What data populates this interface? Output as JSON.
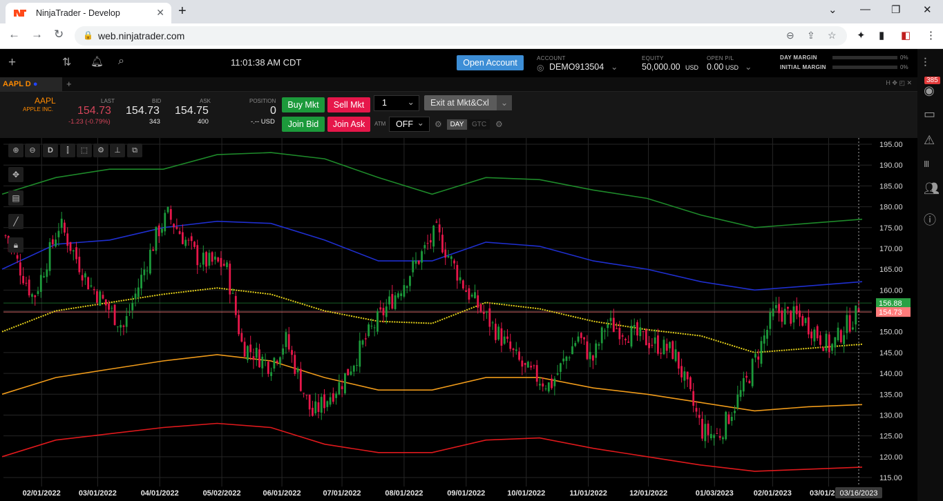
{
  "browser": {
    "tab_title": "NinjaTrader - Develop",
    "url": "web.ninjatrader.com"
  },
  "header": {
    "clock": "11:01:38 AM CDT",
    "open_account_label": "Open Account",
    "account_label": "ACCOUNT",
    "account_value": "DEMO913504",
    "equity_label": "EQUITY",
    "equity_value": "50,000.00",
    "equity_unit": "USD",
    "openpl_label": "OPEN P/L",
    "openpl_value": "0.00",
    "openpl_unit": "USD",
    "day_margin_label": "DAY MARGIN",
    "day_margin_pct": "0%",
    "init_margin_label": "INITIAL MARGIN",
    "init_margin_pct": "0%",
    "notif_badge": "385"
  },
  "chart_tab": {
    "label": "AAPL D",
    "window_controls": "H ✥ ◰ ✕"
  },
  "trade": {
    "symbol": "AAPL",
    "symbol_name": "APPLE INC.",
    "last_label": "LAST",
    "last_value": "154.73",
    "last_change": "-1.23 (-0.79%)",
    "bid_label": "BID",
    "bid_value": "154.73",
    "bid_size": "343",
    "ask_label": "ASK",
    "ask_value": "154.75",
    "ask_size": "400",
    "position_label": "POSITION",
    "position_value": "0",
    "position_usd": "-.-- USD",
    "buy_mkt": "Buy Mkt",
    "sell_mkt": "Sell Mkt",
    "join_bid": "Join Bid",
    "join_ask": "Join Ask",
    "qty": "1",
    "exit_label": "Exit at Mkt&Cxl",
    "atm_label": "ATM",
    "atm_value": "OFF",
    "tif_day": "DAY",
    "tif_gtc": "GTC",
    "up_color": "#1c9a3b",
    "down_color": "#e6174a"
  },
  "chart_data": {
    "type": "candlestick",
    "symbol": "AAPL",
    "interval": "D",
    "ylim": [
      112,
      197
    ],
    "y_ticks": [
      "195.00",
      "190.00",
      "185.00",
      "180.00",
      "175.00",
      "170.00",
      "165.00",
      "160.00",
      "155.00",
      "150.00",
      "145.00",
      "140.00",
      "135.00",
      "130.00",
      "125.00",
      "120.00",
      "115.00"
    ],
    "x_ticks": [
      "02/01/2022",
      "03/01/2022",
      "04/01/2022",
      "05/02/2022",
      "06/01/2022",
      "07/01/2022",
      "08/01/2022",
      "09/01/2022",
      "10/01/2022",
      "11/01/2022",
      "12/01/2022",
      "01/03/2023",
      "02/01/2023",
      "03/01/2023"
    ],
    "crosshair_date": "03/16/2023",
    "price_labels": [
      {
        "value": 156.88,
        "text": "156.88",
        "color": "#2aa144"
      },
      {
        "value": 154.73,
        "text": "154.73",
        "color": "#ff7b7b"
      }
    ],
    "close_path": [
      {
        "date": "01/14/2022",
        "close": 173
      },
      {
        "date": "01/28/2022",
        "close": 158
      },
      {
        "date": "02/10/2022",
        "close": 176
      },
      {
        "date": "02/24/2022",
        "close": 162
      },
      {
        "date": "03/14/2022",
        "close": 151
      },
      {
        "date": "03/31/2022",
        "close": 174
      },
      {
        "date": "04/05/2022",
        "close": 178
      },
      {
        "date": "04/21/2022",
        "close": 167
      },
      {
        "date": "05/04/2022",
        "close": 166
      },
      {
        "date": "05/12/2022",
        "close": 147
      },
      {
        "date": "05/26/2022",
        "close": 142
      },
      {
        "date": "06/03/2022",
        "close": 148
      },
      {
        "date": "06/16/2022",
        "close": 130
      },
      {
        "date": "07/01/2022",
        "close": 138
      },
      {
        "date": "07/15/2022",
        "close": 150
      },
      {
        "date": "08/01/2022",
        "close": 162
      },
      {
        "date": "08/17/2022",
        "close": 174
      },
      {
        "date": "09/01/2022",
        "close": 160
      },
      {
        "date": "09/30/2022",
        "close": 141
      },
      {
        "date": "10/13/2022",
        "close": 137
      },
      {
        "date": "10/27/2022",
        "close": 149
      },
      {
        "date": "11/03/2022",
        "close": 143
      },
      {
        "date": "11/10/2022",
        "close": 152
      },
      {
        "date": "11/30/2022",
        "close": 148
      },
      {
        "date": "12/14/2022",
        "close": 145
      },
      {
        "date": "12/28/2022",
        "close": 126
      },
      {
        "date": "01/05/2023",
        "close": 125
      },
      {
        "date": "01/19/2023",
        "close": 138
      },
      {
        "date": "02/02/2023",
        "close": 155
      },
      {
        "date": "02/16/2023",
        "close": 153
      },
      {
        "date": "03/02/2023",
        "close": 146
      },
      {
        "date": "03/09/2023",
        "close": 151
      },
      {
        "date": "03/16/2023",
        "close": 154.73
      }
    ],
    "series": [
      {
        "name": "green band",
        "color": "#1e8a2a",
        "values": [
          183,
          187,
          189,
          189,
          192.5,
          193,
          191.5,
          187,
          183,
          187,
          186.5,
          184,
          182,
          178,
          175,
          176,
          177
        ]
      },
      {
        "name": "blue band",
        "color": "#1f2fd0",
        "values": [
          165,
          171,
          172,
          175,
          176.5,
          176,
          172,
          167,
          167,
          171.5,
          170.5,
          167,
          165,
          162,
          160,
          161,
          162
        ]
      },
      {
        "name": "yellow band",
        "color": "#e6d21a",
        "values": [
          150,
          155,
          157,
          159,
          160.5,
          159,
          155,
          152.5,
          152,
          157,
          155.5,
          152.5,
          150.5,
          149,
          145,
          146,
          147
        ]
      },
      {
        "name": "orange band",
        "color": "#f09b1a",
        "values": [
          135,
          139,
          141,
          143,
          144.5,
          143,
          139,
          136,
          136,
          139,
          139,
          136.5,
          135,
          133,
          131,
          132,
          132.5
        ]
      },
      {
        "name": "red band",
        "color": "#e0191c",
        "values": [
          120,
          124,
          125.5,
          127,
          128,
          127,
          123,
          121,
          121,
          124,
          124.5,
          122,
          120,
          118,
          116.5,
          117,
          117.5
        ]
      }
    ]
  }
}
